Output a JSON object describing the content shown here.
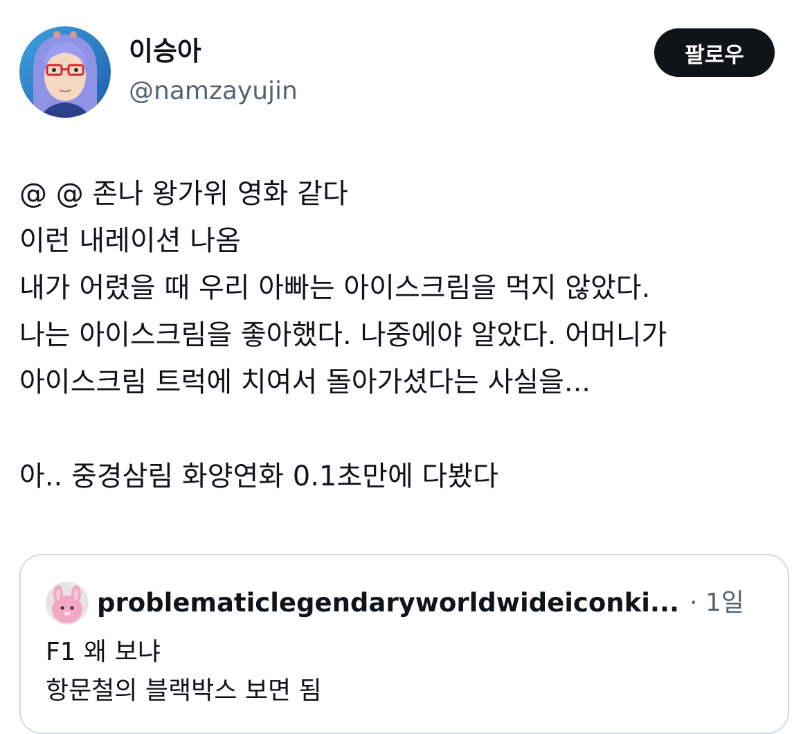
{
  "author": {
    "display_name": "이승아",
    "handle": "@namzayujin",
    "avatar_icon": "anime-avatar-icon"
  },
  "follow_button": {
    "label": "팔로우"
  },
  "tweet": {
    "lines": [
      "@ @ 존나 왕가위 영화 같다",
      "이런 내레이션 나옴",
      "내가 어렸을 때 우리 아빠는 아이스크림을 먹지 않았다.",
      "나는 아이스크림을 좋아했다. 나중에야 알았다. 어머니가",
      "아이스크림 트럭에 치여서 돌아가셨다는 사실을...",
      "",
      "아.. 중경삼림 화양연화 0.1초만에 다봤다"
    ]
  },
  "quoted_tweet": {
    "display_name": "problematiclegendaryworldwideiconki...",
    "time": "· 1일",
    "avatar_icon": "pink-plush-avatar-icon",
    "lines": [
      "F1 왜 보냐",
      "항문철의 블랙박스 보면 됨"
    ]
  },
  "colors": {
    "text": "#0f1419",
    "secondary": "#536471",
    "border": "#cfd9de",
    "button_bg": "#0f1419",
    "button_text": "#ffffff"
  }
}
